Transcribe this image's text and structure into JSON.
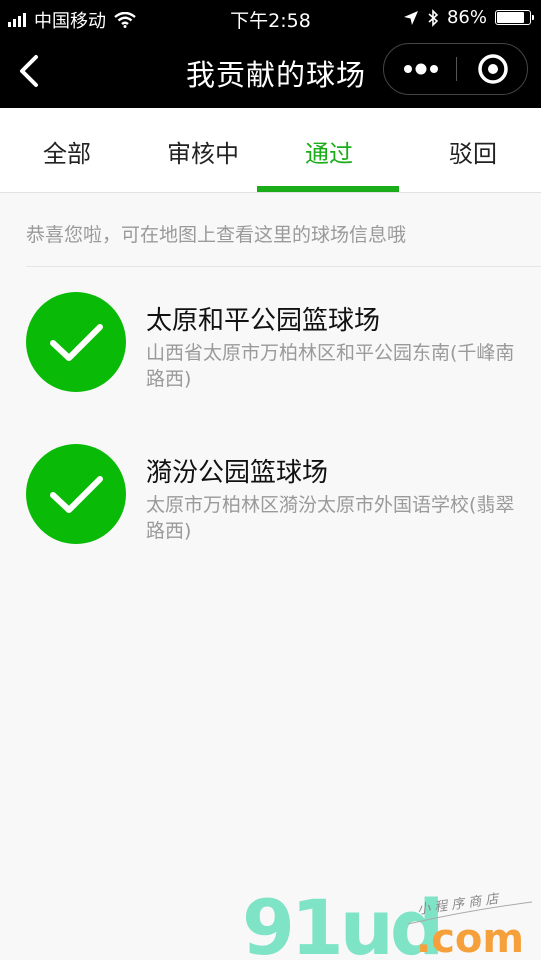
{
  "status_bar": {
    "carrier": "中国移动",
    "time": "下午2:58",
    "battery_percent": "86%",
    "battery_level": 0.86
  },
  "nav": {
    "title": "我贡献的球场"
  },
  "tabs": [
    {
      "label": "全部",
      "active": false
    },
    {
      "label": "审核中",
      "active": false
    },
    {
      "label": "通过",
      "active": true
    },
    {
      "label": "驳回",
      "active": false
    }
  ],
  "notice": "恭喜您啦，可在地图上查看这里的球场信息哦",
  "courts": [
    {
      "name": "太原和平公园篮球场",
      "address": "山西省太原市万柏林区和平公园东南(千峰南路西)"
    },
    {
      "name": "漪汾公园篮球场",
      "address": "太原市万柏林区漪汾太原市外国语学校(翡翠路西)"
    }
  ],
  "watermark": {
    "logo": "91ud",
    "domain": ".com",
    "tagline": "小程序商店"
  },
  "colors": {
    "accent": "#1aad19",
    "check_green": "#09bb07",
    "nav_bg": "#000000"
  }
}
